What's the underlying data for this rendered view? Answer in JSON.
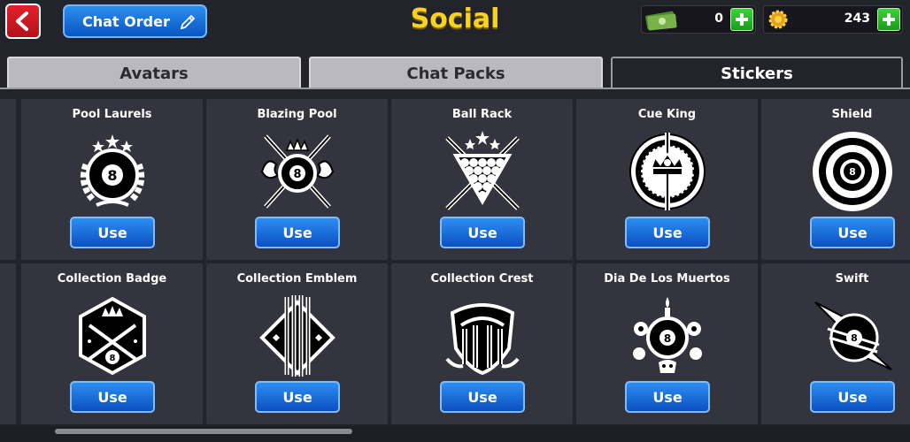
{
  "header": {
    "back_label": "",
    "chat_order_label": "Chat Order",
    "title": "Social",
    "cash_value": "0",
    "coins_value": "243"
  },
  "tabs": [
    {
      "label": "Avatars",
      "active": false
    },
    {
      "label": "Chat Packs",
      "active": false
    },
    {
      "label": "Stickers",
      "active": true
    }
  ],
  "stickers": [
    {
      "name": "Pool Laurels",
      "icon": "pool-laurels-icon",
      "button": "Use"
    },
    {
      "name": "Blazing Pool",
      "icon": "blazing-pool-icon",
      "button": "Use"
    },
    {
      "name": "Ball Rack",
      "icon": "ball-rack-icon",
      "button": "Use"
    },
    {
      "name": "Cue King",
      "icon": "cue-king-icon",
      "button": "Use"
    },
    {
      "name": "Shield",
      "icon": "shield-icon",
      "button": "Use"
    },
    {
      "name": "Collection Badge",
      "icon": "collection-badge-icon",
      "button": "Use"
    },
    {
      "name": "Collection Emblem",
      "icon": "collection-emblem-icon",
      "button": "Use"
    },
    {
      "name": "Collection Crest",
      "icon": "collection-crest-icon",
      "button": "Use"
    },
    {
      "name": "Dia De Los Muertos",
      "icon": "dia-de-los-muertos-icon",
      "button": "Use"
    },
    {
      "name": "Swift",
      "icon": "swift-icon",
      "button": "Use"
    }
  ],
  "colors": {
    "accent_blue": "#0b4fc1",
    "title_yellow": "#f7d21e",
    "plus_green": "#1b9b1c",
    "back_red": "#d11a24"
  }
}
